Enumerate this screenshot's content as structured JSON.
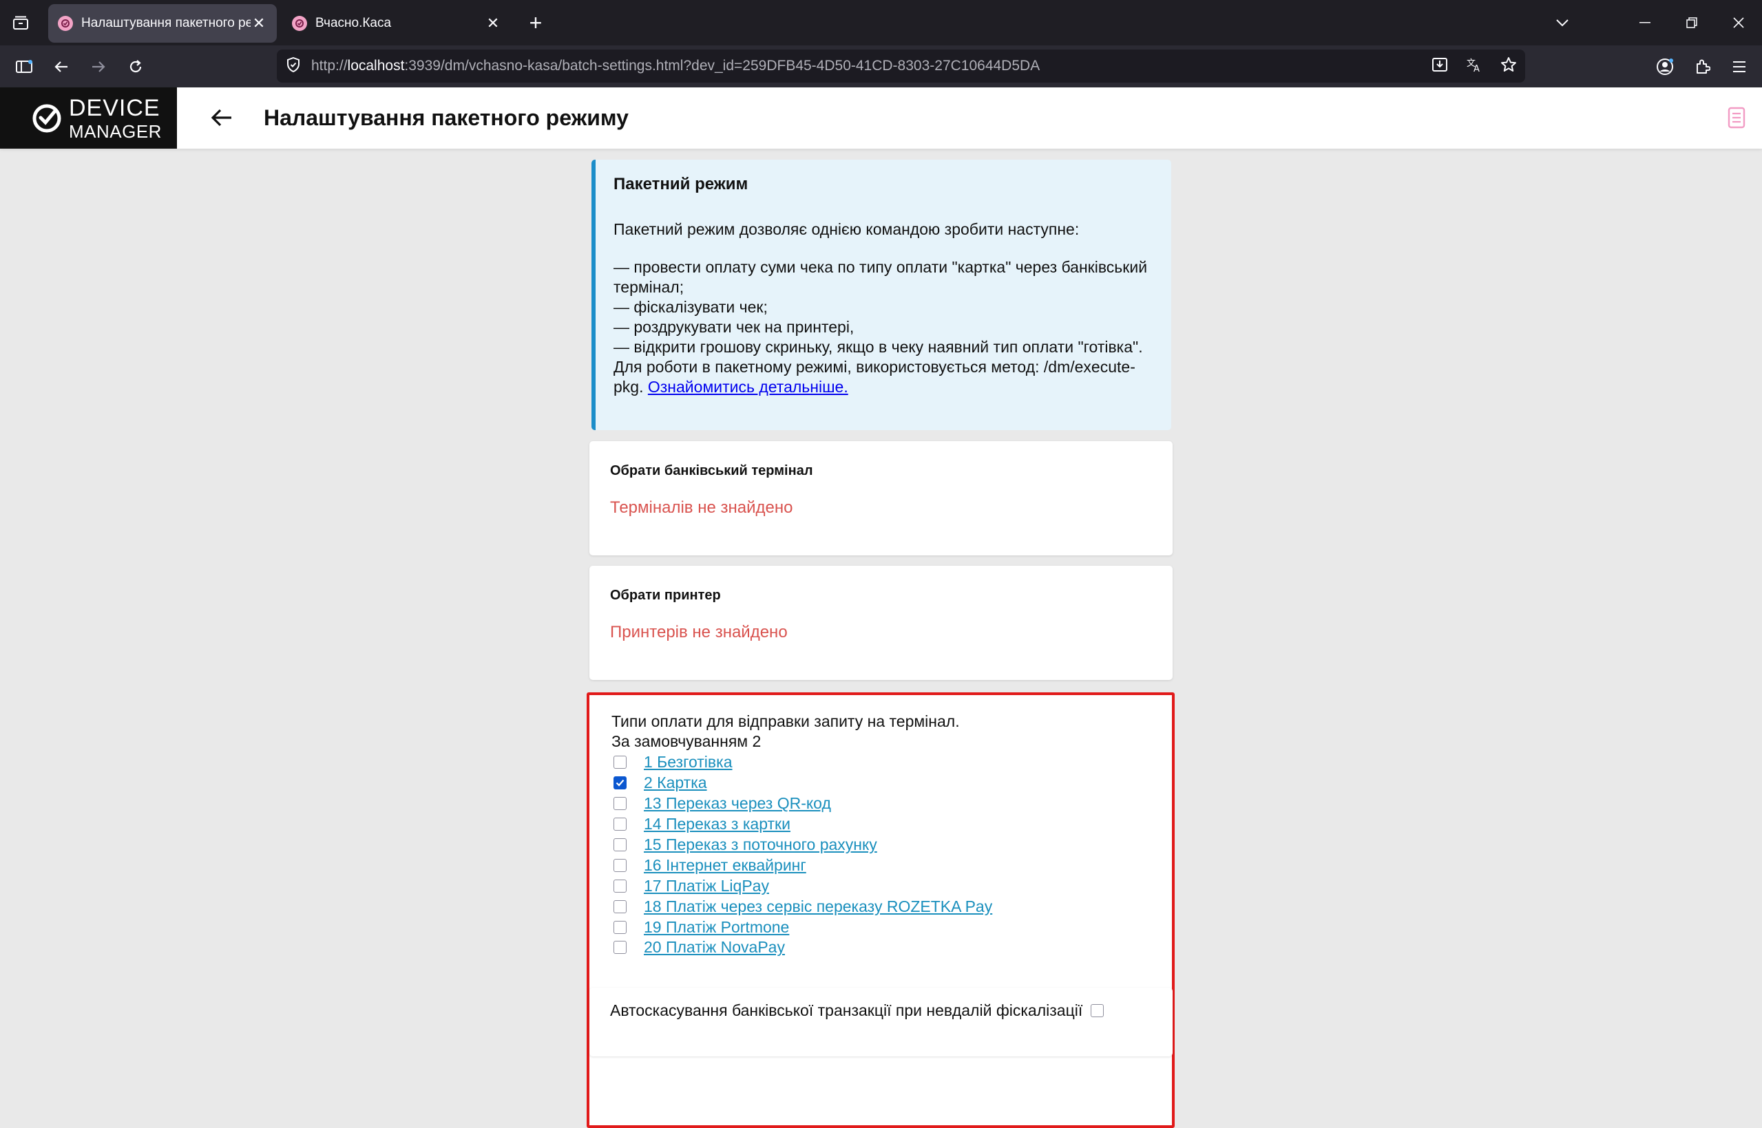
{
  "browser": {
    "tabs": [
      {
        "title": "Налаштування пакетного режи",
        "active": true
      },
      {
        "title": "Вчасно.Каса",
        "active": false
      }
    ],
    "url_prefix": "http://",
    "url_host": "localhost",
    "url_rest": ":3939/dm/vchasno-kasa/batch-settings.html?dev_id=259DFB45-4D50-41CD-8303-27C10644D5DA"
  },
  "app": {
    "logo_line1": "DEVICE",
    "logo_line2": "MANAGER",
    "page_title": "Налаштування пакетного режиму"
  },
  "info": {
    "title": "Пакетний режим",
    "intro": "Пакетний режим дозволяє однією командою зробити наступне:",
    "lines": [
      "— провести оплату суми чека по типу оплати \"картка\" через банківський термінал;",
      "— фіскалізувати чек;",
      "— роздрукувати чек на принтері,",
      "— відкрити грошову скриньку, якщо в чеку наявний тип оплати \"готівка\".",
      "Для роботи в пакетному режимі, використовується метод: /dm/execute-pkg."
    ],
    "link_text": "Ознайомитись детальніше."
  },
  "terminal": {
    "title": "Обрати банківський термінал",
    "empty": "Терміналів не знайдено"
  },
  "printer": {
    "title": "Обрати принтер",
    "empty": "Принтерів не знайдено"
  },
  "payments": {
    "heading": "Типи оплати для відправки запиту на термінал.",
    "default_note": "За замовчуванням 2",
    "items": [
      {
        "label": "1 Безготівка",
        "checked": false
      },
      {
        "label": "2 Картка",
        "checked": true
      },
      {
        "label": "13 Переказ через QR-код",
        "checked": false
      },
      {
        "label": "14 Переказ з картки",
        "checked": false
      },
      {
        "label": "15 Переказ з поточного рахунку",
        "checked": false
      },
      {
        "label": "16 Інтернет еквайринг",
        "checked": false
      },
      {
        "label": "17 Платіж LiqPay",
        "checked": false
      },
      {
        "label": "18 Платіж через сервіс переказу ROZETKA Pay",
        "checked": false
      },
      {
        "label": "19 Платіж Portmone",
        "checked": false
      },
      {
        "label": "20 Платіж NovaPay",
        "checked": false
      }
    ]
  },
  "autocancel": {
    "label": "Автоскасування банківської транзакції при невдалій фіскалізації",
    "checked": false
  },
  "colors": {
    "accent_border": "#1b8dc9",
    "error_text": "#d9534f",
    "highlight_frame": "#e11a1a",
    "link": "#1a8fbd"
  }
}
